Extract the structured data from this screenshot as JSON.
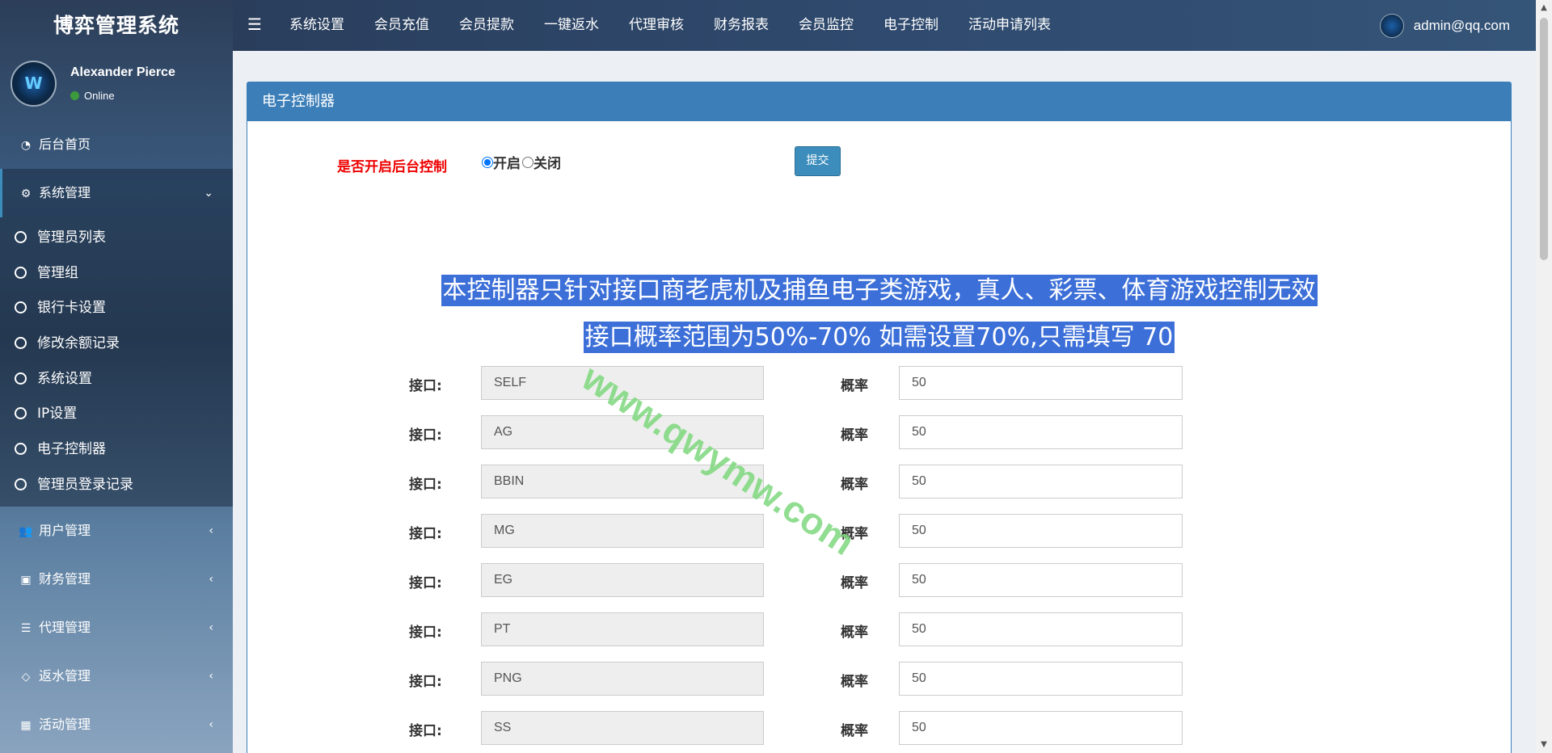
{
  "app": {
    "title": "博弈管理系统"
  },
  "user": {
    "name": "Alexander Pierce",
    "status": "Online",
    "email": "admin@qq.com"
  },
  "sidebar": {
    "items": [
      {
        "label": "后台首页",
        "icon": "dashboard-icon"
      },
      {
        "label": "系统管理",
        "icon": "gear-icon",
        "expanded": true
      }
    ],
    "submenu": [
      "管理员列表",
      "管理组",
      "银行卡设置",
      "修改余额记录",
      "系统设置",
      "IP设置",
      "电子控制器",
      "管理员登录记录"
    ],
    "groups": [
      {
        "label": "用户管理",
        "icon": "users-icon"
      },
      {
        "label": "财务管理",
        "icon": "money-icon"
      },
      {
        "label": "代理管理",
        "icon": "list-icon"
      },
      {
        "label": "返水管理",
        "icon": "code-icon"
      },
      {
        "label": "活动管理",
        "icon": "map-icon"
      }
    ]
  },
  "topnav": [
    "系统设置",
    "会员充值",
    "会员提款",
    "一键返水",
    "代理审核",
    "财务报表",
    "会员监控",
    "电子控制",
    "活动申请列表"
  ],
  "panel": {
    "title": "电子控制器",
    "control_label": "是否开启后台控制",
    "option_on": "开启",
    "option_off": "关闭",
    "submit": "提交",
    "notice1": "本控制器只针对接口商老虎机及捕鱼电子类游戏，真人、彩票、体育游戏控制无效",
    "notice2": "接口概率范围为50%-70% 如需设置70%,只需填写 70",
    "iface_label": "接口:",
    "prob_label": "概率",
    "rows": [
      {
        "iface": "SELF",
        "prob": "50"
      },
      {
        "iface": "AG",
        "prob": "50"
      },
      {
        "iface": "BBIN",
        "prob": "50"
      },
      {
        "iface": "MG",
        "prob": "50"
      },
      {
        "iface": "EG",
        "prob": "50"
      },
      {
        "iface": "PT",
        "prob": "50"
      },
      {
        "iface": "PNG",
        "prob": "50"
      },
      {
        "iface": "SS",
        "prob": "50"
      }
    ]
  },
  "watermark": "www.qwymw.com",
  "colors": {
    "accent": "#3c7fb8",
    "warning": "#e00000",
    "watermark": "#7ed87e"
  }
}
